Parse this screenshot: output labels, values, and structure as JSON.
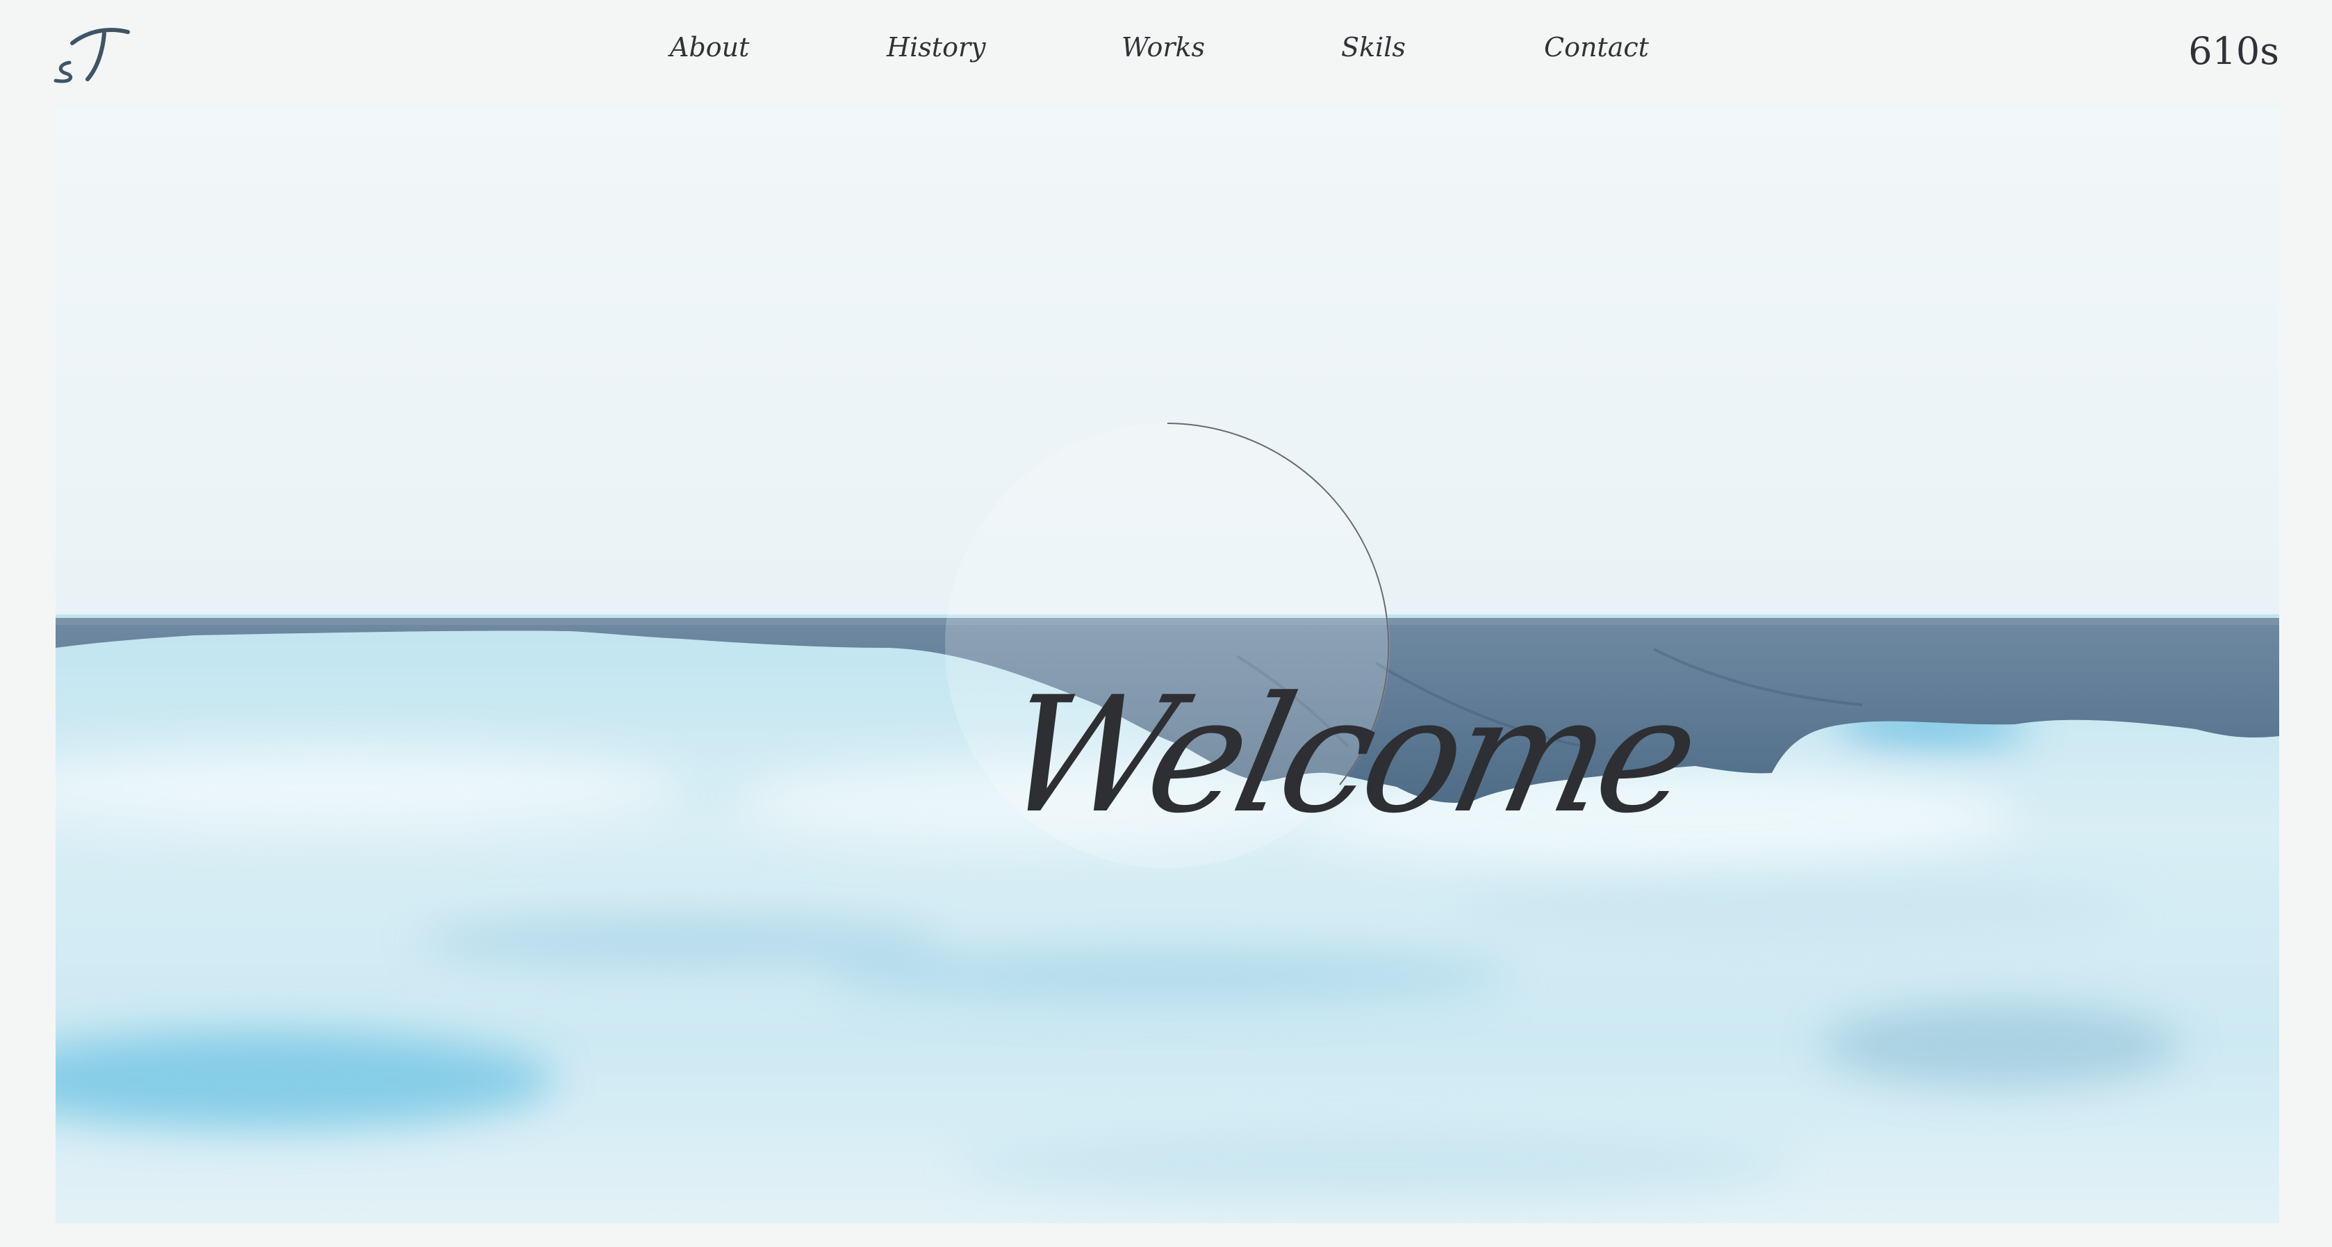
{
  "header": {
    "logo_text": "sT",
    "nav": [
      "About",
      "History",
      "Works",
      "Skils",
      "Contact"
    ],
    "counter": "610s"
  },
  "hero": {
    "title": "Welcome"
  },
  "colors": {
    "page_bg": "#f4f6f6",
    "text": "#2f3337",
    "logo": "#3e5565",
    "sky": "#eef5f8",
    "mountain": "#5d7a95",
    "sea": "#8fd0e6"
  }
}
